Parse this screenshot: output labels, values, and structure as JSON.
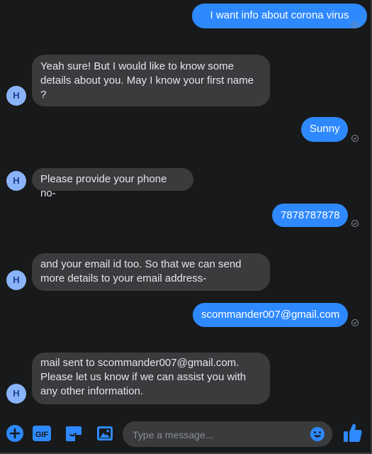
{
  "messages": [
    {
      "id": "m1",
      "side": "out",
      "text": "I want info about corona virus"
    },
    {
      "id": "m2",
      "side": "in",
      "avatar": "H",
      "text": "Yeah sure! But I would like to know some\ndetails about you. May I know your first name\n?"
    },
    {
      "id": "m3",
      "side": "out",
      "text": "Sunny"
    },
    {
      "id": "m4",
      "side": "in",
      "avatar": "H",
      "text": "Please provide your phone no-"
    },
    {
      "id": "m5",
      "side": "out",
      "text": "7878787878"
    },
    {
      "id": "m6",
      "side": "in",
      "avatar": "H",
      "text": "and your email id too. So that we can send\nmore details to your email address-"
    },
    {
      "id": "m7",
      "side": "out",
      "text": "scommander007@gmail.com"
    },
    {
      "id": "m8",
      "side": "in",
      "avatar": "H",
      "text": "mail sent to scommander007@gmail.com.\nPlease let us know if we can assist you with\nany other information."
    }
  ],
  "composer": {
    "placeholder": "Type a message...",
    "icons": [
      "plus-icon",
      "gif-icon",
      "sticker-icon",
      "image-icon",
      "emoji-icon",
      "thumbs-up-icon"
    ]
  },
  "colors": {
    "background": "#18191a",
    "outgoing_bubble": "#2e89ff",
    "incoming_bubble": "#3a3b3c",
    "accent": "#2e89ff"
  }
}
